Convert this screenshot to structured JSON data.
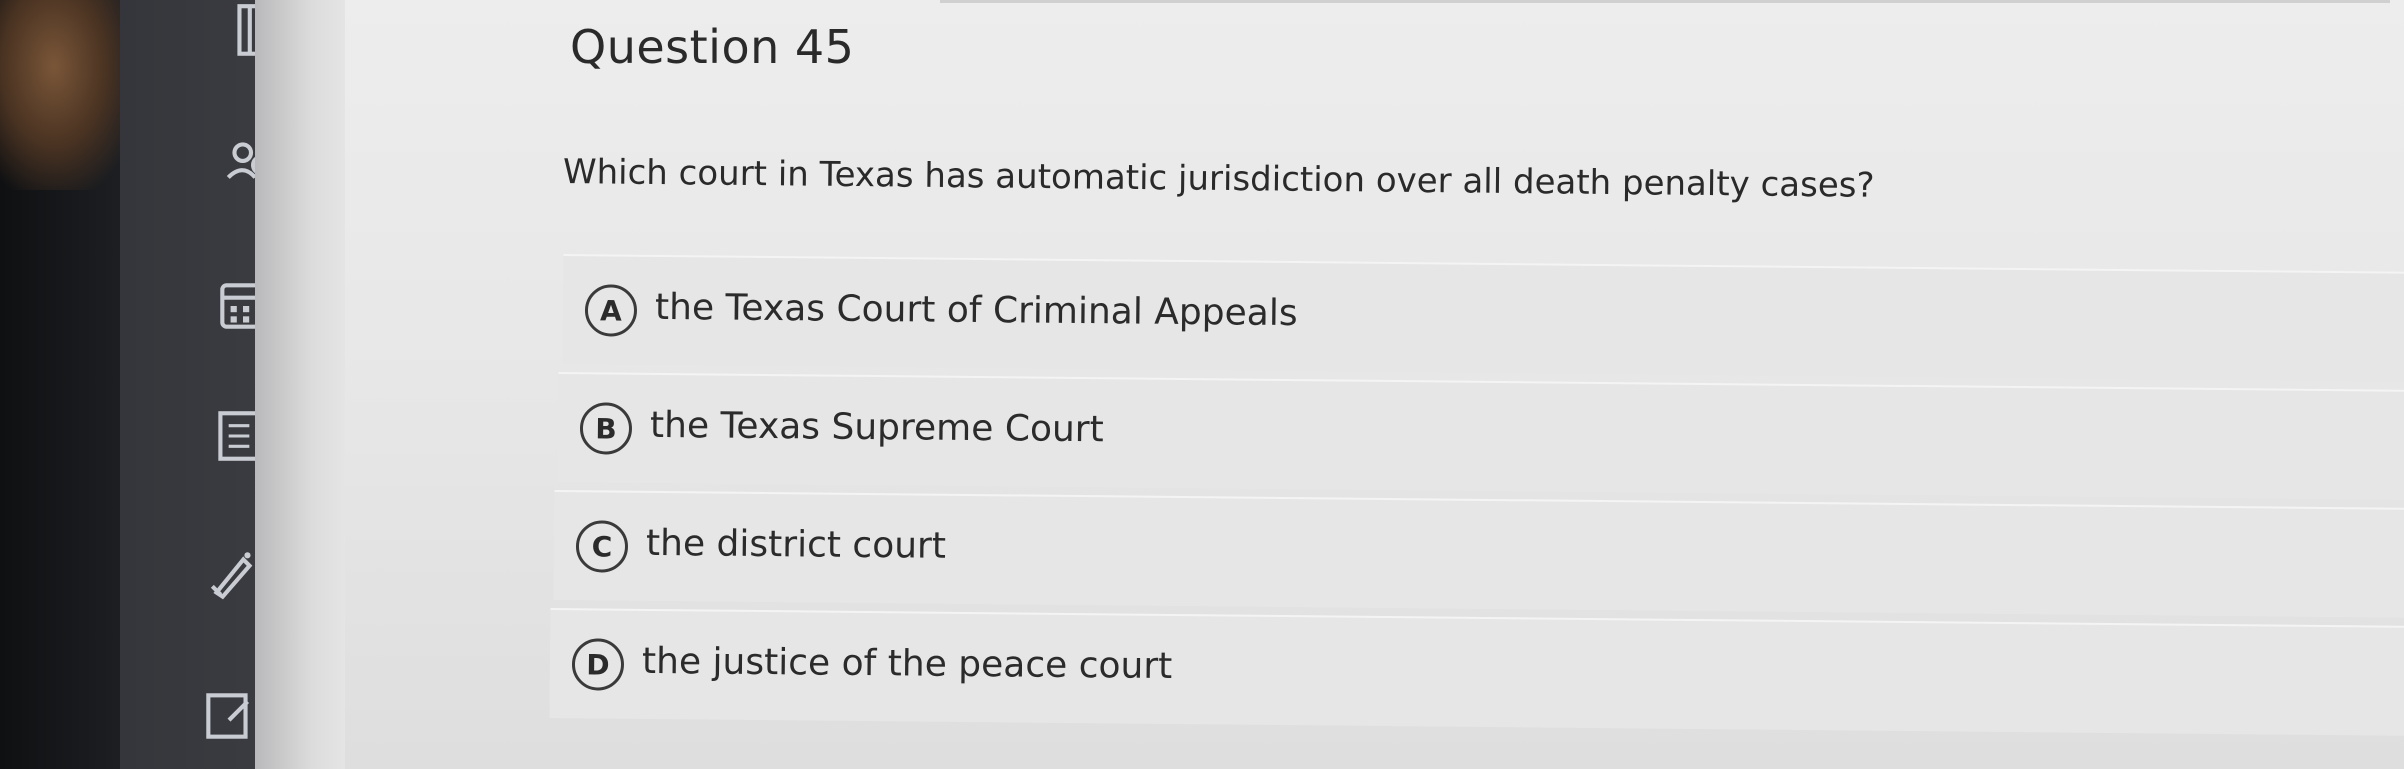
{
  "question": {
    "title": "Question 45",
    "prompt": "Which court in Texas has automatic jurisdiction over all death penalty cases?"
  },
  "choices": [
    {
      "letter": "A",
      "text": "the Texas Court of Criminal Appeals"
    },
    {
      "letter": "B",
      "text": "the Texas Supreme Court"
    },
    {
      "letter": "C",
      "text": "the district court"
    },
    {
      "letter": "D",
      "text": "the justice of the peace court"
    }
  ],
  "nav": {
    "icons": [
      "book-icon",
      "users-icon",
      "calendar-icon",
      "notes-icon",
      "rocket-icon",
      "edit-icon"
    ]
  },
  "colors": {
    "panel_background": "#e7e7e7",
    "choice_background": "#e6e6e6",
    "nav_rail": "#36383d",
    "text": "#2a2a2a"
  }
}
